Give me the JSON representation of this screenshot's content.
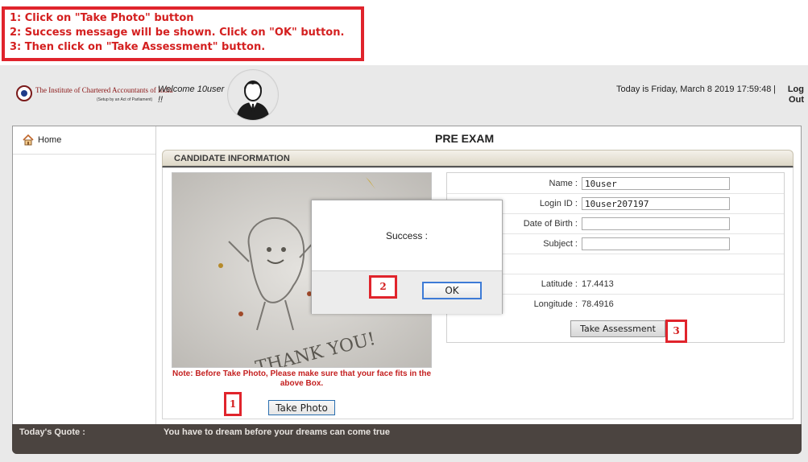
{
  "instructions": [
    "1: Click on \"Take Photo\" button",
    "2: Success message will be shown. Click on \"OK\" button.",
    "3: Then click on \"Take Assessment\" button."
  ],
  "header": {
    "logo_name": "The Institute of Chartered Accountants of India",
    "logo_sub": "(Setup by an Act of Parliament)",
    "welcome_line1": "Welcome 10user",
    "welcome_line2": "!!",
    "date": "Today is Friday, March 8 2019 17:59:48",
    "separator": "|",
    "logout_line1": "Log",
    "logout_line2": "Out"
  },
  "nav": {
    "home": "Home"
  },
  "page_title": "PRE EXAM",
  "section_title": "CANDIDATE INFORMATION",
  "photo_note": "Note: Before Take Photo, Please make sure that your face fits in the above Box.",
  "take_photo_label": "Take Photo",
  "info": {
    "name_label": "Name :",
    "name_value": "10user",
    "login_label": "Login ID :",
    "login_value": "10user207197",
    "dob_label": "Date of Birth :",
    "dob_value": "",
    "subject_label": "Subject :",
    "subject_value": "",
    "lat_label": "Latitude :",
    "lat_value": "17.4413",
    "lon_label": "Longitude :",
    "lon_value": "78.4916"
  },
  "take_assessment_label": "Take Assessment",
  "quote": {
    "label": "Today's Quote :",
    "text": "You have to dream before your dreams can come true"
  },
  "modal": {
    "message": "Success :",
    "ok_label": "OK"
  },
  "markers": {
    "one": "1",
    "two": "2",
    "three": "3"
  },
  "colors": {
    "accent_red": "#e0242c",
    "quote_bar": "#4b4440",
    "ok_border": "#3d7bd6"
  }
}
